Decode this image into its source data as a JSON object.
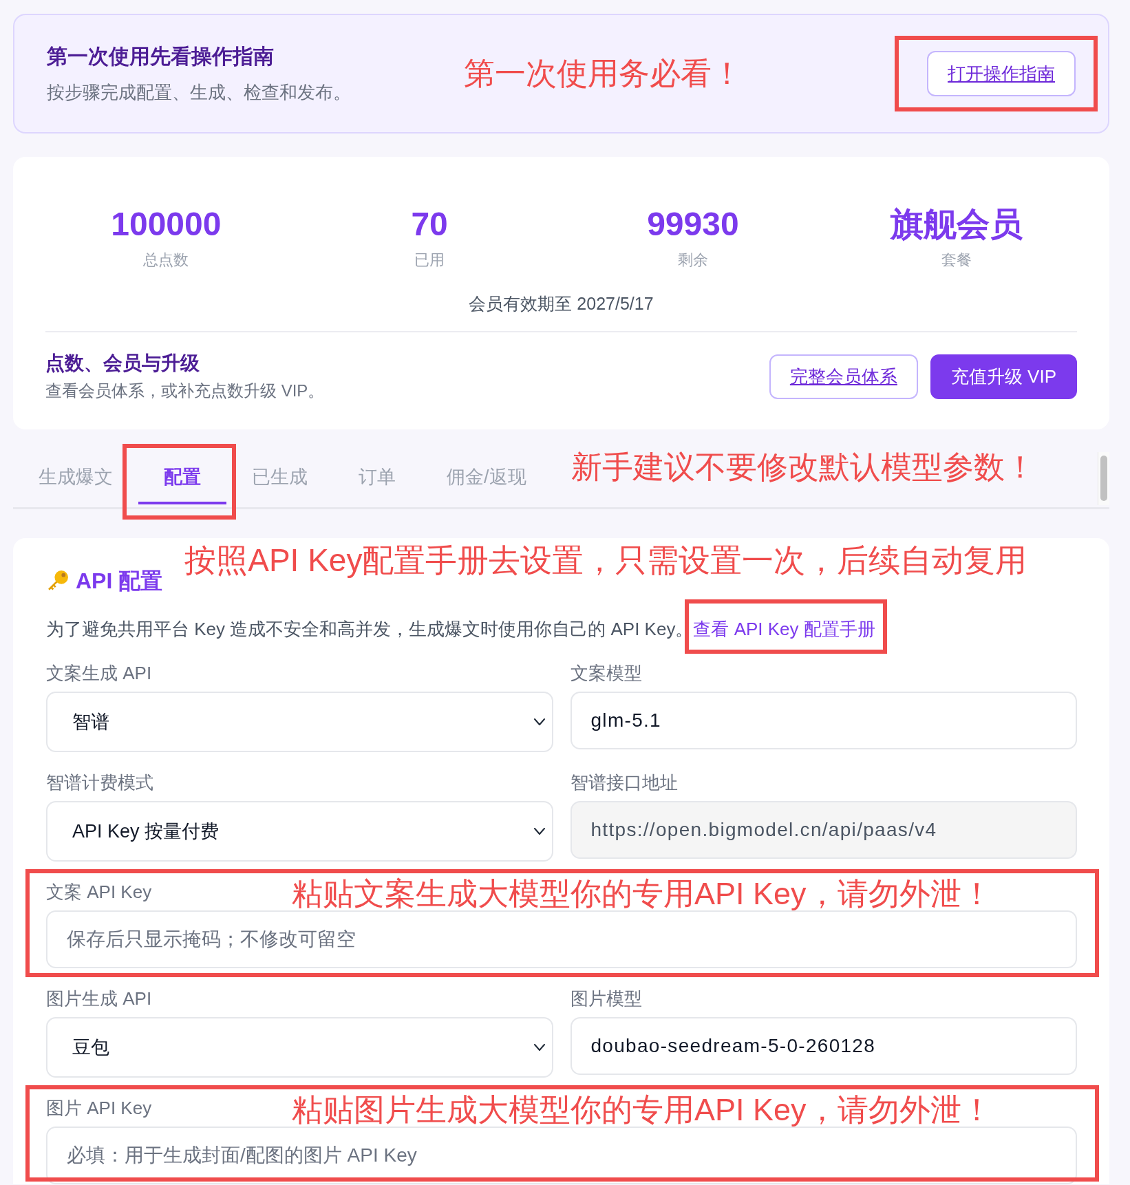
{
  "guide": {
    "title": "第一次使用先看操作指南",
    "subtitle": "按步骤完成配置、生成、检查和发布。",
    "annotation": "第一次使用务必看！",
    "button": {
      "label": "打开操作指南",
      "highlighted": true
    }
  },
  "stats": {
    "items": [
      {
        "value": "100000",
        "label": "总点数"
      },
      {
        "value": "70",
        "label": "已用"
      },
      {
        "value": "99930",
        "label": "剩余"
      },
      {
        "value": "旗舰会员",
        "label": "套餐"
      }
    ],
    "expiry": "会员有效期至 2027/5/17",
    "upgrade": {
      "title": "点数、会员与升级",
      "subtitle": "查看会员体系，或补充点数升级 VIP。",
      "buttons": [
        {
          "label": "完整会员体系",
          "kind": "outline"
        },
        {
          "label": "充值升级 VIP",
          "kind": "primary"
        }
      ]
    }
  },
  "tabs": {
    "items": [
      {
        "label": "生成爆文",
        "selected": false,
        "highlighted": false
      },
      {
        "label": "配置",
        "selected": true,
        "highlighted": true
      },
      {
        "label": "已生成",
        "selected": false,
        "highlighted": false
      },
      {
        "label": "订单",
        "selected": false,
        "highlighted": false
      },
      {
        "label": "佣金/返现",
        "selected": false,
        "highlighted": false
      }
    ],
    "annotation": "新手建议不要修改默认模型参数！"
  },
  "api_config": {
    "title": "API 配置",
    "annotation": "按照API Key配置手册去设置，只需设置一次，后续自动复用",
    "description": "为了避免共用平台 Key 造成不安全和高并发，生成爆文时使用你自己的 API Key。",
    "link": {
      "label": "查看 API Key 配置手册",
      "highlighted": true
    },
    "fields": [
      {
        "label": "文案生成 API",
        "kind": "select",
        "value": "智谱",
        "disabled": false,
        "highlighted": false
      },
      {
        "label": "文案模型",
        "kind": "text",
        "value": "glm-5.1",
        "disabled": false,
        "highlighted": false
      },
      {
        "label": "智谱计费模式",
        "kind": "select",
        "value": "API Key 按量付费",
        "disabled": false,
        "highlighted": false
      },
      {
        "label": "智谱接口地址",
        "kind": "text",
        "value": "https://open.bigmodel.cn/api/paas/v4",
        "disabled": true,
        "highlighted": false
      },
      {
        "label": "文案 API Key",
        "kind": "secret",
        "placeholder": "保存后只显示掩码；不修改可留空",
        "disabled": false,
        "highlighted": true,
        "annotation": "粘贴文案生成大模型你的专用API Key，请勿外泄！"
      },
      {
        "label": "图片生成 API",
        "kind": "select",
        "value": "豆包",
        "disabled": false,
        "highlighted": false
      },
      {
        "label": "图片模型",
        "kind": "text",
        "value": "doubao-seedream-5-0-260128",
        "disabled": false,
        "highlighted": false
      },
      {
        "label": "图片 API Key",
        "kind": "secret",
        "placeholder": "必填：用于生成封面/配图的图片 API Key",
        "disabled": false,
        "highlighted": true,
        "annotation": "粘贴图片生成大模型你的专用API Key，请勿外泄！"
      }
    ]
  }
}
